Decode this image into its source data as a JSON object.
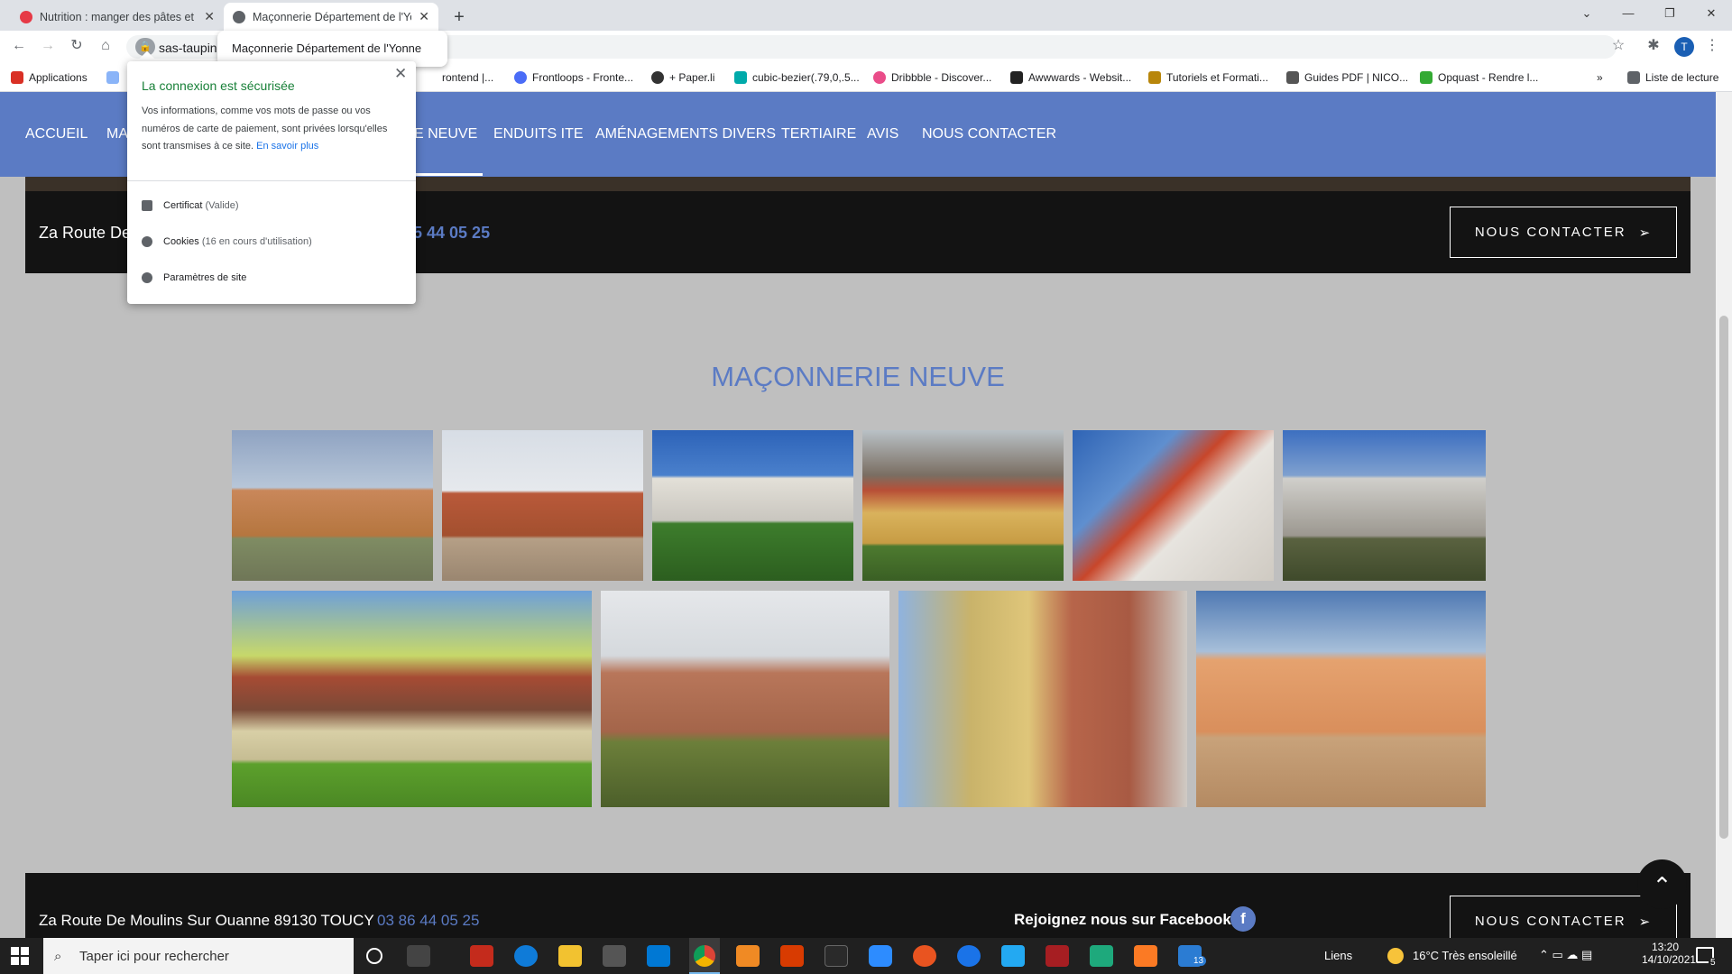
{
  "browser": {
    "tabs": [
      {
        "title": "Nutrition : manger des pâtes et c",
        "favicon_color": "#e63946"
      },
      {
        "title": "Maçonnerie Département de l'Yo",
        "favicon_color": "#5f6368",
        "active": true
      }
    ],
    "tooltip": "Maçonnerie Département de l'Yonne",
    "url": "sas-taupin.",
    "profile_initial": "T",
    "bookmarks": [
      {
        "label": "Applications",
        "icon": "apps-grid-icon"
      },
      {
        "label": "rontend |...",
        "icon": "bookmark-icon"
      },
      {
        "label": "Frontloops - Fronte...",
        "icon": "frontloops-icon"
      },
      {
        "label": "+ Paper.li",
        "icon": "paperli-icon"
      },
      {
        "label": "cubic-bezier(.79,0,.5...",
        "icon": "cubic-bezier-icon"
      },
      {
        "label": "Dribbble - Discover...",
        "icon": "dribbble-icon"
      },
      {
        "label": "Awwwards - Websit...",
        "icon": "awwwards-icon"
      },
      {
        "label": "Tutoriels et Formati...",
        "icon": "tutoriels-icon"
      },
      {
        "label": "Guides PDF | NICO...",
        "icon": "guides-icon"
      },
      {
        "label": "Opquast - Rendre l...",
        "icon": "opquast-icon"
      }
    ],
    "reading_list": "Liste de lecture",
    "more_bookmarks": "»"
  },
  "security_popup": {
    "title": "La connexion est sécurisée",
    "description": "Vos informations, comme vos mots de passe ou vos numéros de carte de paiement, sont privées lorsqu'elles sont transmises à ce site.",
    "learn_more": "En savoir plus",
    "certificate_label": "Certificat",
    "certificate_status": "(Valide)",
    "cookies_label": "Cookies",
    "cookies_status": "(16 en cours d'utilisation)",
    "site_settings": "Paramètres de site"
  },
  "site": {
    "nav": [
      "ACCUEIL",
      "MA",
      "E NEUVE",
      "ENDUITS ITE",
      "AMÉNAGEMENTS DIVERS",
      "TERTIAIRE",
      "AVIS",
      "NOUS CONTACTER"
    ],
    "top_info": {
      "address": "Za Route De",
      "phone": "5 44 05 25"
    },
    "contact_button": "NOUS CONTACTER",
    "section_title": "MAÇONNERIE NEUVE",
    "footer": {
      "address": "Za Route De Moulins Sur Ouanne 89130 TOUCY",
      "phone": "03 86 44 05 25",
      "facebook_text": "Rejoignez nous sur Facebook",
      "facebook_letter": "f"
    }
  },
  "taskbar": {
    "search_placeholder": "Taper ici pour rechercher",
    "links": "Liens",
    "weather": "16°C  Très ensoleillé",
    "time": "13:20",
    "date": "14/10/2021",
    "notif_count": "5",
    "badge": "13"
  }
}
